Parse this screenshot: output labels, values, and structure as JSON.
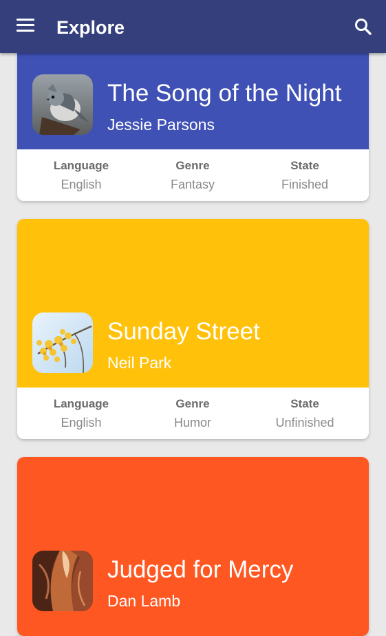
{
  "app": {
    "title": "Explore",
    "accent": "#343f7c"
  },
  "cards": [
    {
      "title": "The Song of the Night",
      "author": "Jessie Parsons",
      "color": "#3f51b5",
      "cover_icon": "bird-cover-image",
      "language_label": "Language",
      "language": "English",
      "genre_label": "Genre",
      "genre": "Fantasy",
      "state_label": "State",
      "state": "Finished"
    },
    {
      "title": "Sunday Street",
      "author": "Neil Park",
      "color": "#ffc10a",
      "cover_icon": "leaves-cover-image",
      "language_label": "Language",
      "language": "English",
      "genre_label": "Genre",
      "genre": "Humor",
      "state_label": "State",
      "state": "Unfinished"
    },
    {
      "title": "Judged for Mercy",
      "author": "Dan Lamb",
      "color": "#ff5722",
      "cover_icon": "canyon-cover-image"
    }
  ]
}
